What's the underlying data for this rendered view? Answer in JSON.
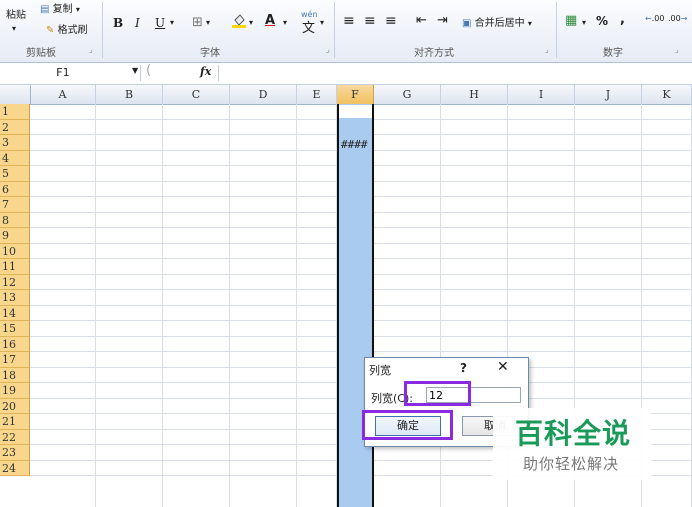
{
  "ribbon": {
    "clipboard": {
      "paste_label": "粘贴",
      "copy_label": "复制",
      "format_painter_label": "格式刷",
      "group_label": "剪贴板"
    },
    "font": {
      "bold": "B",
      "italic": "I",
      "underline": "U",
      "wen": "wén",
      "group_label": "字体"
    },
    "alignment": {
      "merge_center_label": "合并后居中",
      "group_label": "对齐方式"
    },
    "number": {
      "percent": "%",
      "comma": ",",
      "inc_dec": ".00",
      "dec_dec": ".00",
      "group_label": "数字"
    }
  },
  "formula_bar": {
    "name_box": "F1",
    "fx": "fx"
  },
  "grid": {
    "columns": [
      "A",
      "B",
      "C",
      "D",
      "E",
      "F",
      "G",
      "H",
      "I",
      "J",
      "K"
    ],
    "rows": [
      "1",
      "2",
      "3",
      "4",
      "5",
      "6",
      "7",
      "8",
      "9",
      "10",
      "11",
      "12",
      "13",
      "14",
      "15",
      "16",
      "17",
      "18",
      "19",
      "20",
      "21",
      "22",
      "23",
      "24"
    ],
    "cell_F8": "####"
  },
  "dialog": {
    "title": "列宽",
    "help": "?",
    "close": "✕",
    "width_label": "列宽(C):",
    "width_value": "12",
    "ok_label": "确定",
    "cancel_label": "取消"
  },
  "watermark": {
    "main": "百科全说",
    "sub": "助你轻松解决"
  }
}
